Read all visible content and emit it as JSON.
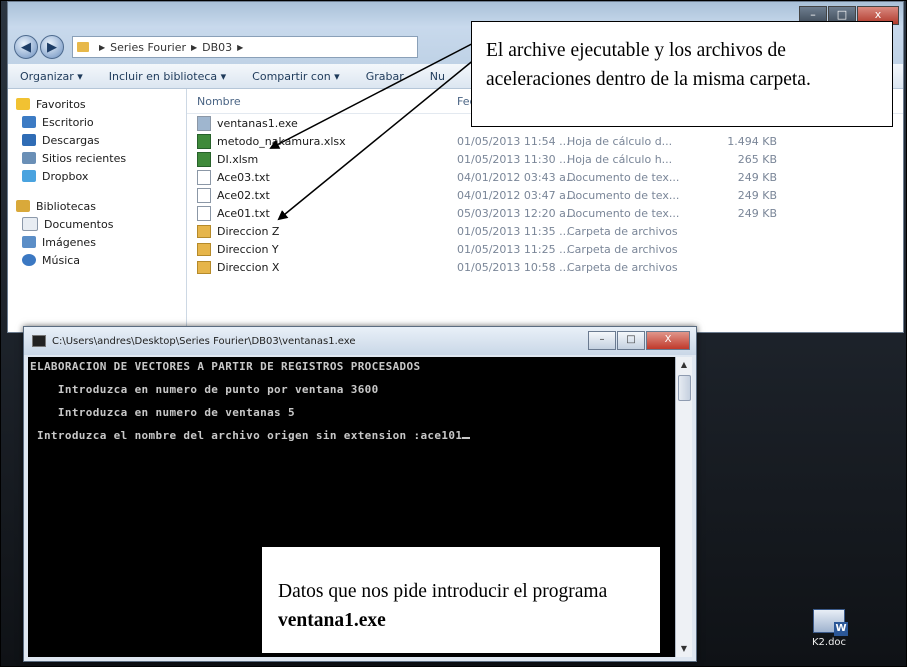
{
  "explorer": {
    "window_controls": [
      "–",
      "□",
      "x"
    ],
    "breadcrumb": [
      "Series Fourier",
      "DB03"
    ],
    "toolbar": [
      "Organizar ▾",
      "Incluir en biblioteca ▾",
      "Compartir con ▾",
      "Grabar",
      "Nu"
    ],
    "columns": [
      "Nombre",
      "Fec"
    ],
    "sidebar": {
      "favorites_label": "Favoritos",
      "favorites": [
        "Escritorio",
        "Descargas",
        "Sitios recientes",
        "Dropbox"
      ],
      "libraries_label": "Bibliotecas",
      "libraries": [
        "Documentos",
        "Imágenes",
        "Música"
      ]
    },
    "files": [
      {
        "name": "ventanas1.exe",
        "date": "",
        "type": "",
        "size": ""
      },
      {
        "name": "metodo_nakamura.xlsx",
        "date": "01/05/2013 11:54 ...",
        "type": "Hoja de cálculo d...",
        "size": "1.494 KB"
      },
      {
        "name": "DI.xlsm",
        "date": "01/05/2013 11:30 ...",
        "type": "Hoja de cálculo h...",
        "size": "265 KB"
      },
      {
        "name": "Ace03.txt",
        "date": "04/01/2012 03:43 a...",
        "type": "Documento de tex...",
        "size": "249 KB"
      },
      {
        "name": "Ace02.txt",
        "date": "04/01/2012 03:47 a...",
        "type": "Documento de tex...",
        "size": "249 KB"
      },
      {
        "name": "Ace01.txt",
        "date": "05/03/2013 12:20 a...",
        "type": "Documento de tex...",
        "size": "249 KB"
      },
      {
        "name": "Direccion Z",
        "date": "01/05/2013 11:35 ...",
        "type": "Carpeta de archivos",
        "size": ""
      },
      {
        "name": "Direccion Y",
        "date": "01/05/2013 11:25 ...",
        "type": "Carpeta de archivos",
        "size": ""
      },
      {
        "name": "Direccion X",
        "date": "01/05/2013 10:58 ...",
        "type": "Carpeta de archivos",
        "size": ""
      }
    ]
  },
  "console": {
    "title": "C:\\Users\\andres\\Desktop\\Series Fourier\\DB03\\ventanas1.exe",
    "controls": [
      "–",
      "□",
      "X"
    ],
    "lines": [
      "ELABORACION DE VECTORES A PARTIR DE REGISTROS PROCESADOS",
      "    Introduzca en numero de punto por ventana 3600",
      "    Introduzca en numero de ventanas 5",
      " Introduzca el nombre del archivo origen sin extension :ace101"
    ]
  },
  "desktop_icon": {
    "label": "K2.doc"
  },
  "annotations": {
    "top": "El archive ejecutable y los archivos de aceleraciones dentro de la misma carpeta.",
    "bottom_prefix": "Datos que nos pide introducir el programa ",
    "bottom_bold": "ventana1.exe"
  }
}
